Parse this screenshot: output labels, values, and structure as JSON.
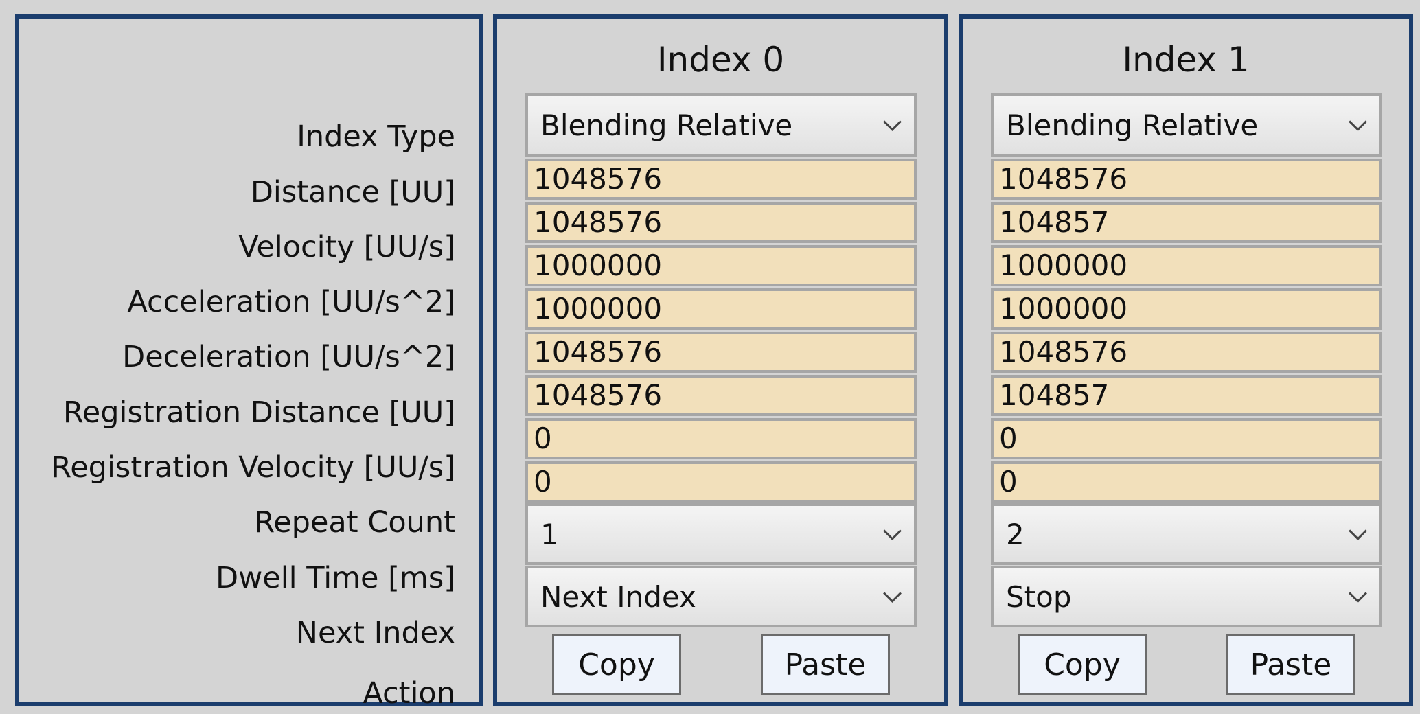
{
  "labels": [
    "Index Type",
    "Distance [UU]",
    "Velocity [UU/s]",
    "Acceleration [UU/s^2]",
    "Deceleration [UU/s^2]",
    "Registration Distance [UU]",
    "Registration Velocity [UU/s]",
    "Repeat Count",
    "Dwell Time [ms]",
    "Next Index",
    "Action"
  ],
  "indexes": [
    {
      "title": "Index 0",
      "index_type": "Blending Relative",
      "fields": [
        "1048576",
        "1048576",
        "1000000",
        "1000000",
        "1048576",
        "1048576",
        "0",
        "0"
      ],
      "repeat_select": "1",
      "action_select": "Next Index",
      "copy_label": "Copy",
      "paste_label": "Paste"
    },
    {
      "title": "Index 1",
      "index_type": "Blending Relative",
      "fields": [
        "1048576",
        "104857",
        "1000000",
        "1000000",
        "1048576",
        "104857",
        "0",
        "0"
      ],
      "repeat_select": "2",
      "action_select": "Stop",
      "copy_label": "Copy",
      "paste_label": "Paste"
    }
  ],
  "icons": {
    "dropdown": "chevron-down-icon"
  },
  "colors": {
    "panel_border": "#1b3d6d",
    "background": "#d4d4d4",
    "field_fill": "#f2e0bb",
    "button_fill": "#eef3fb"
  }
}
